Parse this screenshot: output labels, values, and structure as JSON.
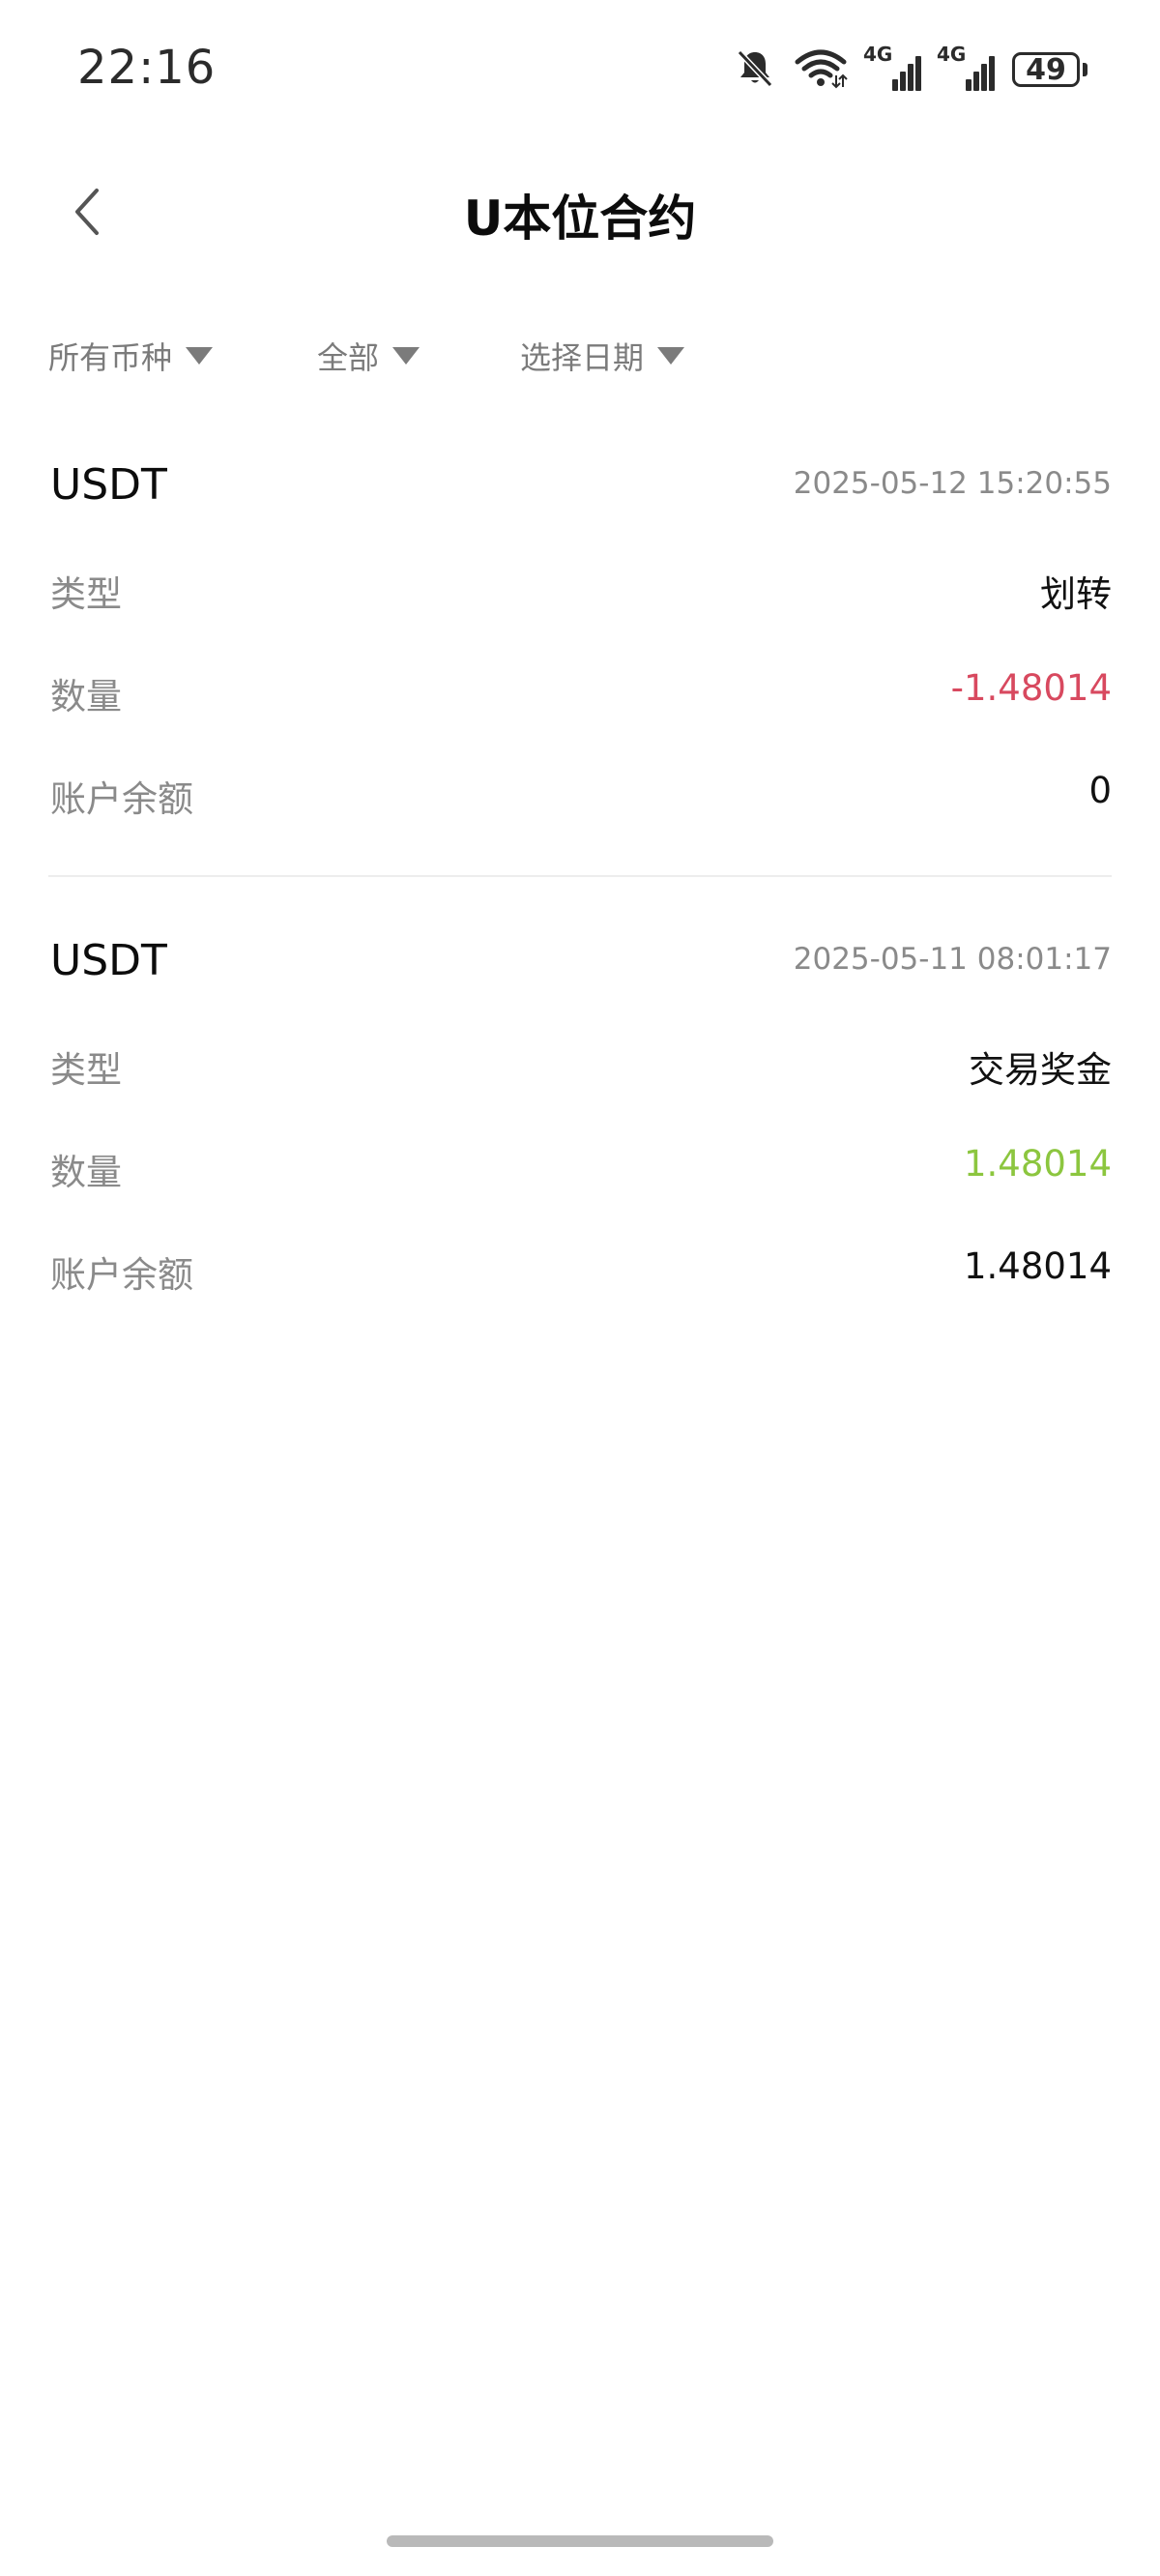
{
  "status_bar": {
    "time": "22:16",
    "icons": [
      "bell-off-icon",
      "wifi-icon",
      "signal-4g-icon",
      "signal-4g-icon",
      "battery-icon"
    ],
    "network_label": "4G",
    "battery": "49"
  },
  "header": {
    "title": "U本位合约",
    "back_icon": "chevron-left-icon"
  },
  "filters": [
    {
      "label": "所有币种",
      "icon": "caret-down-icon"
    },
    {
      "label": "全部",
      "icon": "caret-down-icon"
    },
    {
      "label": "选择日期",
      "icon": "caret-down-icon"
    }
  ],
  "records": [
    {
      "currency": "USDT",
      "time": "2025-05-12 15:20:55",
      "rows": [
        {
          "label": "类型",
          "value": "划转"
        },
        {
          "label": "数量",
          "value": "-1.48014"
        },
        {
          "label": "账户余额",
          "value": "0"
        }
      ]
    },
    {
      "currency": "USDT",
      "time": "2025-05-11 08:01:17",
      "rows": [
        {
          "label": "类型",
          "value": "交易奖金"
        },
        {
          "label": "数量",
          "value": "1.48014"
        },
        {
          "label": "账户余额",
          "value": "1.48014"
        }
      ]
    }
  ],
  "colors": {
    "negative": "#d8495f",
    "positive": "#8cc63f",
    "label": "#8a8a8a",
    "text": "#111111"
  }
}
